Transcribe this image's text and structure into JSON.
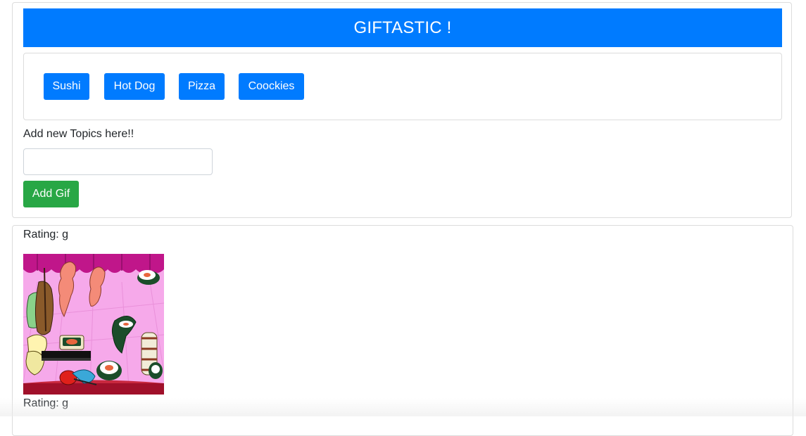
{
  "header": {
    "title": "GIFTASTIC !"
  },
  "topics": [
    {
      "label": "Sushi"
    },
    {
      "label": "Hot Dog"
    },
    {
      "label": "Pizza"
    },
    {
      "label": "Coockies"
    }
  ],
  "form": {
    "label": "Add new Topics here!!",
    "input_value": "",
    "input_placeholder": "",
    "submit_label": "Add Gif"
  },
  "results": [
    {
      "rating": "Rating: g",
      "gif_subject": "sushi orchestra cartoon"
    },
    {
      "rating": "Rating: g"
    }
  ],
  "colors": {
    "primary": "#007bff",
    "success": "#28a745",
    "gif_background": "#f7a8e8",
    "curtain": "#c21a8c"
  }
}
